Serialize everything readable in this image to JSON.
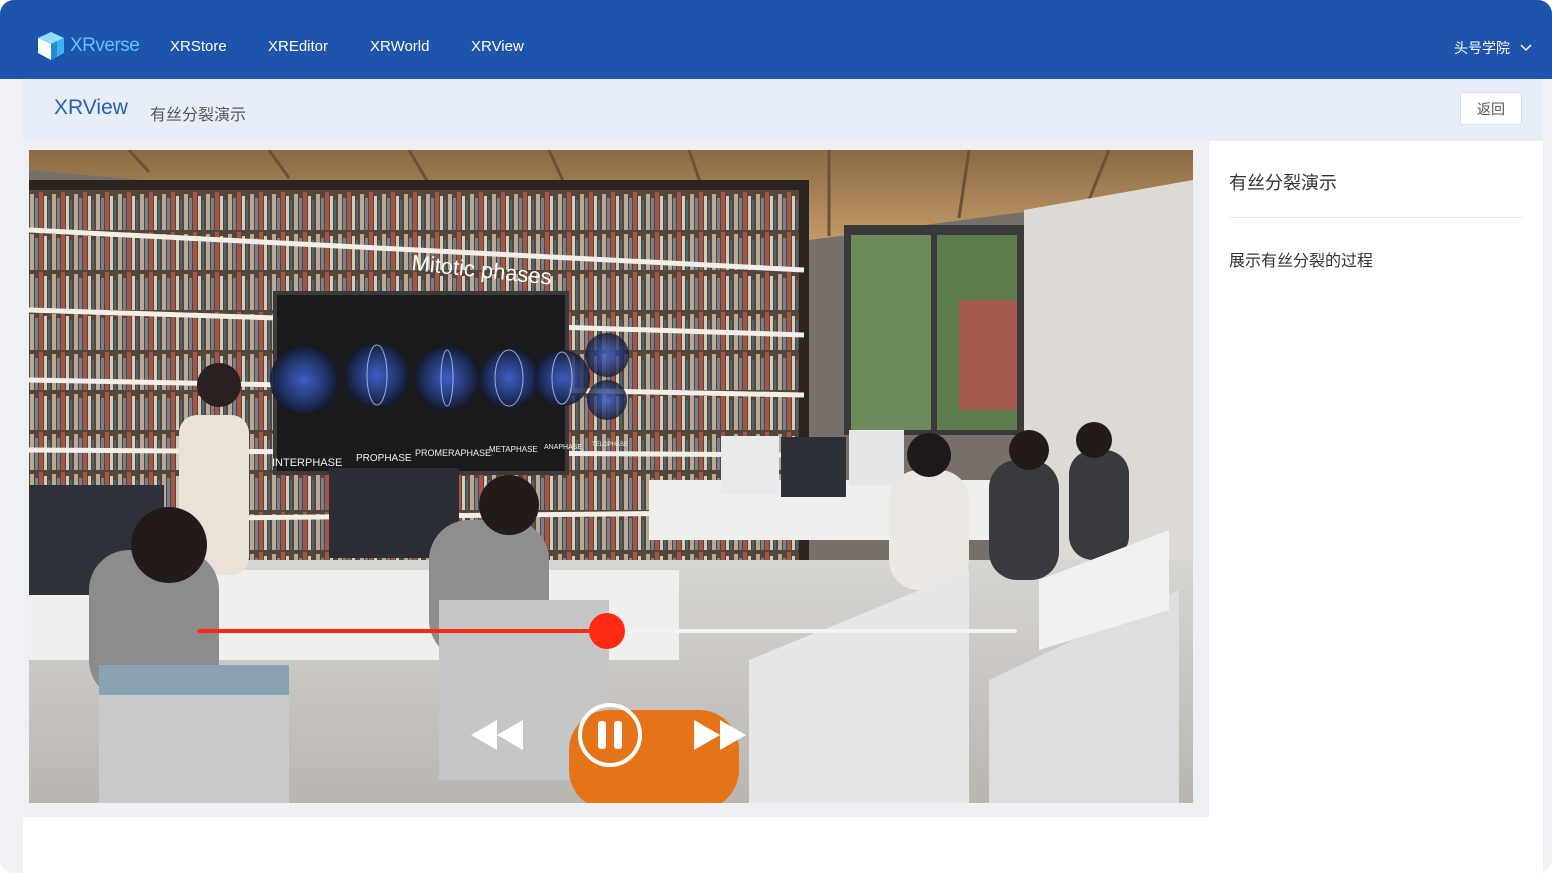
{
  "brand": {
    "name": "XRverse",
    "icon": "cube-logo-icon"
  },
  "nav": {
    "items": [
      {
        "label": "XRStore"
      },
      {
        "label": "XREditor"
      },
      {
        "label": "XRWorld"
      },
      {
        "label": "XRView"
      }
    ],
    "user_label": "头号学院"
  },
  "subheader": {
    "title": "XRView",
    "breadcrumb": "有丝分裂演示",
    "back_label": "返回"
  },
  "video": {
    "overlay_title": "Mitotic phases",
    "phases": [
      "INTERPHASE",
      "PROPHASE",
      "PROMERAPHASE",
      "METAPHASE",
      "ANAPHASE",
      "TELOPHASE"
    ],
    "progress": 0.5,
    "controls": {
      "rewind": "rewind-icon",
      "pause": "pause-icon",
      "forward": "fast-forward-icon"
    }
  },
  "details": {
    "title": "有丝分裂演示",
    "description": "展示有丝分裂的过程"
  },
  "colors": {
    "nav_bg": "#1f54ad",
    "brand_text": "#5cc6ff",
    "subheader_bg": "#e8eef8",
    "subheader_title": "#2a5db0",
    "progress": "#ff2a14"
  }
}
